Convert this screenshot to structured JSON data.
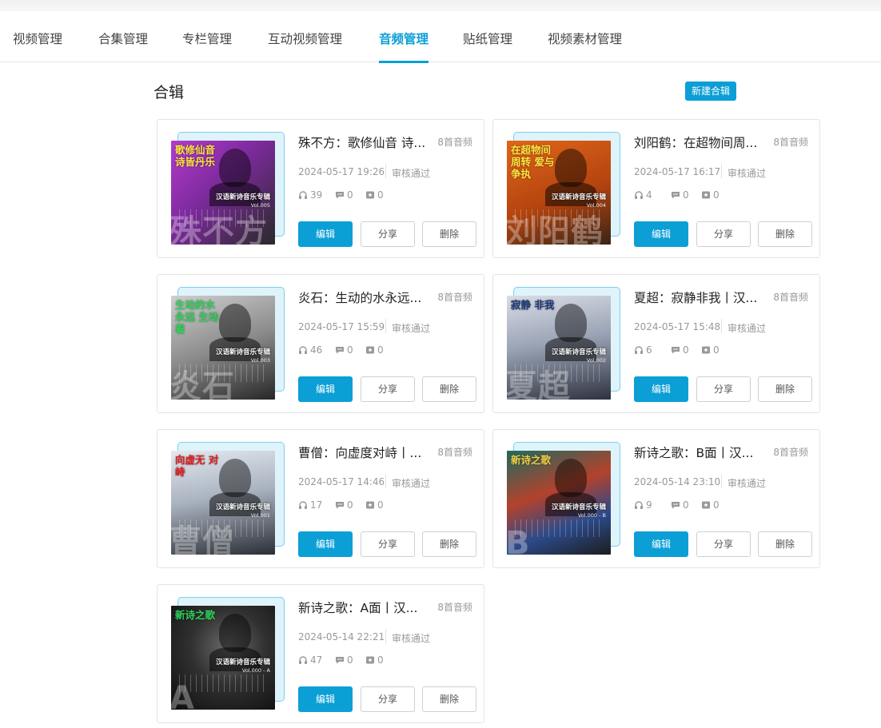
{
  "tabs": [
    {
      "label": "视频管理",
      "active": false
    },
    {
      "label": "合集管理",
      "active": false
    },
    {
      "label": "专栏管理",
      "active": false
    },
    {
      "label": "互动视频管理",
      "active": false
    },
    {
      "label": "音频管理",
      "active": true
    },
    {
      "label": "贴纸管理",
      "active": false
    },
    {
      "label": "视频素材管理",
      "active": false
    }
  ],
  "section": {
    "title": "合辑",
    "new_button": "新建合辑"
  },
  "colors": {
    "accent": "#0b9fd6"
  },
  "cards": [
    {
      "title": "殊不方：歌修仙音 诗...",
      "count": "8首音频",
      "date": "2024-05-17 19:26",
      "status": "审核通过",
      "listens": "39",
      "comments": "0",
      "favorites": "0",
      "edit": "编辑",
      "share": "分享",
      "delete": "删除",
      "cover": {
        "title": "歌修仙音 诗皆丹乐",
        "subtitle": "汉语新诗音乐专辑",
        "vol": "Vol.005",
        "name": "殊不方",
        "bg": "linear-gradient(135deg,#b43ad0 0%,#7a2a9a 45%,#2a2a2a 100%)",
        "title_color": "#ffe640"
      }
    },
    {
      "title": "刘阳鹤：在超物间周...",
      "count": "8首音频",
      "date": "2024-05-17 16:17",
      "status": "审核通过",
      "listens": "4",
      "comments": "0",
      "favorites": "0",
      "edit": "编辑",
      "share": "分享",
      "delete": "删除",
      "cover": {
        "title": "在超物间 周转 爱与争执",
        "subtitle": "汉语新诗音乐专辑",
        "vol": "Vol.004",
        "name": "刘阳鹤",
        "bg": "linear-gradient(160deg,#e0661a 0%,#b4440f 55%,#3a2418 100%)",
        "title_color": "#ffe640"
      }
    },
    {
      "title": "炎石：生动的水永远...",
      "count": "8首音频",
      "date": "2024-05-17 15:59",
      "status": "审核通过",
      "listens": "46",
      "comments": "0",
      "favorites": "0",
      "edit": "编辑",
      "share": "分享",
      "delete": "删除",
      "cover": {
        "title": "生动的水 永远 生动着",
        "subtitle": "汉语新诗音乐专辑",
        "vol": "Vol.003",
        "name": "炎石",
        "bg": "linear-gradient(160deg,#cfcfcf 0%,#8b8b8b 50%,#262626 100%)",
        "title_color": "#2fd45a"
      }
    },
    {
      "title": "夏超：寂静非我丨汉...",
      "count": "8首音频",
      "date": "2024-05-17 15:48",
      "status": "审核通过",
      "listens": "6",
      "comments": "0",
      "favorites": "0",
      "edit": "编辑",
      "share": "分享",
      "delete": "删除",
      "cover": {
        "title": "寂静 非我",
        "subtitle": "汉语新诗音乐专辑",
        "vol": "Vol.002",
        "name": "夏超",
        "bg": "linear-gradient(170deg,#d9dde6 0%,#9aa3b5 45%,#2f3340 100%)",
        "title_color": "#1f3a7a"
      }
    },
    {
      "title": "曹僧：向虚度对峙丨...",
      "count": "8首音频",
      "date": "2024-05-17 14:46",
      "status": "审核通过",
      "listens": "17",
      "comments": "0",
      "favorites": "0",
      "edit": "编辑",
      "share": "分享",
      "delete": "删除",
      "cover": {
        "title": "向虚无 对峙",
        "subtitle": "汉语新诗音乐专辑",
        "vol": "Vol.001",
        "name": "曹僧",
        "bg": "linear-gradient(170deg,#e4e9f0 0%,#a8b2bf 45%,#2b2e35 100%)",
        "title_color": "#e21b1b"
      }
    },
    {
      "title": "新诗之歌：B面丨汉...",
      "count": "8首音频",
      "date": "2024-05-14 23:10",
      "status": "审核通过",
      "listens": "9",
      "comments": "0",
      "favorites": "0",
      "edit": "编辑",
      "share": "分享",
      "delete": "删除",
      "cover": {
        "title": "新诗之歌",
        "subtitle": "汉语新诗音乐专辑",
        "vol": "Vol.000 - B",
        "name": "B",
        "bg": "linear-gradient(160deg,#1f6b5e 0%,#b3422c 40%,#2c4a8a 70%,#1d1d1d 100%)",
        "title_color": "#f2d14a"
      }
    },
    {
      "title": "新诗之歌：A面丨汉...",
      "count": "8首音频",
      "date": "2024-05-14 22:21",
      "status": "审核通过",
      "listens": "47",
      "comments": "0",
      "favorites": "0",
      "edit": "编辑",
      "share": "分享",
      "delete": "删除",
      "cover": {
        "title": "新诗之歌",
        "subtitle": "汉语新诗音乐专辑",
        "vol": "Vol.000 - A",
        "name": "A",
        "bg": "radial-gradient(circle at 55% 40%,#6a6a6a 0%,#303030 45%,#0e0e0e 100%)",
        "title_color": "#2fd45a"
      }
    }
  ]
}
